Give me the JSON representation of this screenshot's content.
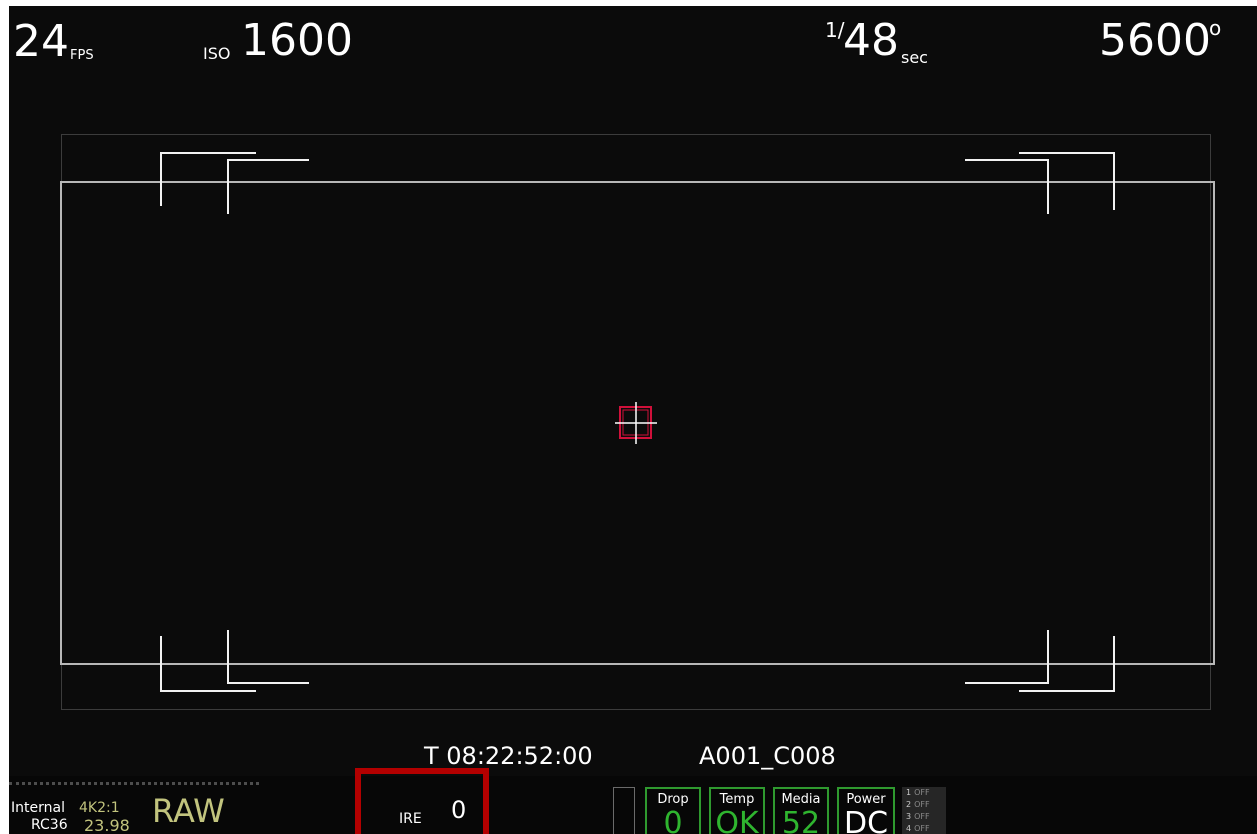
{
  "top": {
    "fps_value": "24",
    "fps_unit": "FPS",
    "iso_label": "ISO",
    "iso_value": "1600",
    "shutter_numerator": "1/",
    "shutter_value": "48",
    "shutter_unit": "sec",
    "white_balance": "5600",
    "white_balance_unit": "o"
  },
  "timecode": "T 08:22:52:00",
  "clip_name": "A001_C008",
  "media": {
    "source": "Internal",
    "resolution": "4K2:1",
    "codec": "RC36",
    "project_fps": "23.98",
    "format": "RAW"
  },
  "ire": {
    "label": "IRE",
    "value": "0"
  },
  "status": [
    {
      "label": "Drop",
      "value": "0"
    },
    {
      "label": "Temp",
      "value": "OK"
    },
    {
      "label": "Media",
      "value": "52"
    },
    {
      "label": "Power",
      "value": "DC"
    }
  ],
  "tally": [
    {
      "num": "1",
      "state": "OFF"
    },
    {
      "num": "2",
      "state": "OFF"
    },
    {
      "num": "3",
      "state": "OFF"
    },
    {
      "num": "4",
      "state": "OFF"
    }
  ],
  "colors": {
    "background": "#0b0b0b",
    "accent_yellow": "#c2c47e",
    "status_green": "#2fb52f",
    "highlight_red": "#b30000",
    "center_marker": "#d0103a"
  }
}
